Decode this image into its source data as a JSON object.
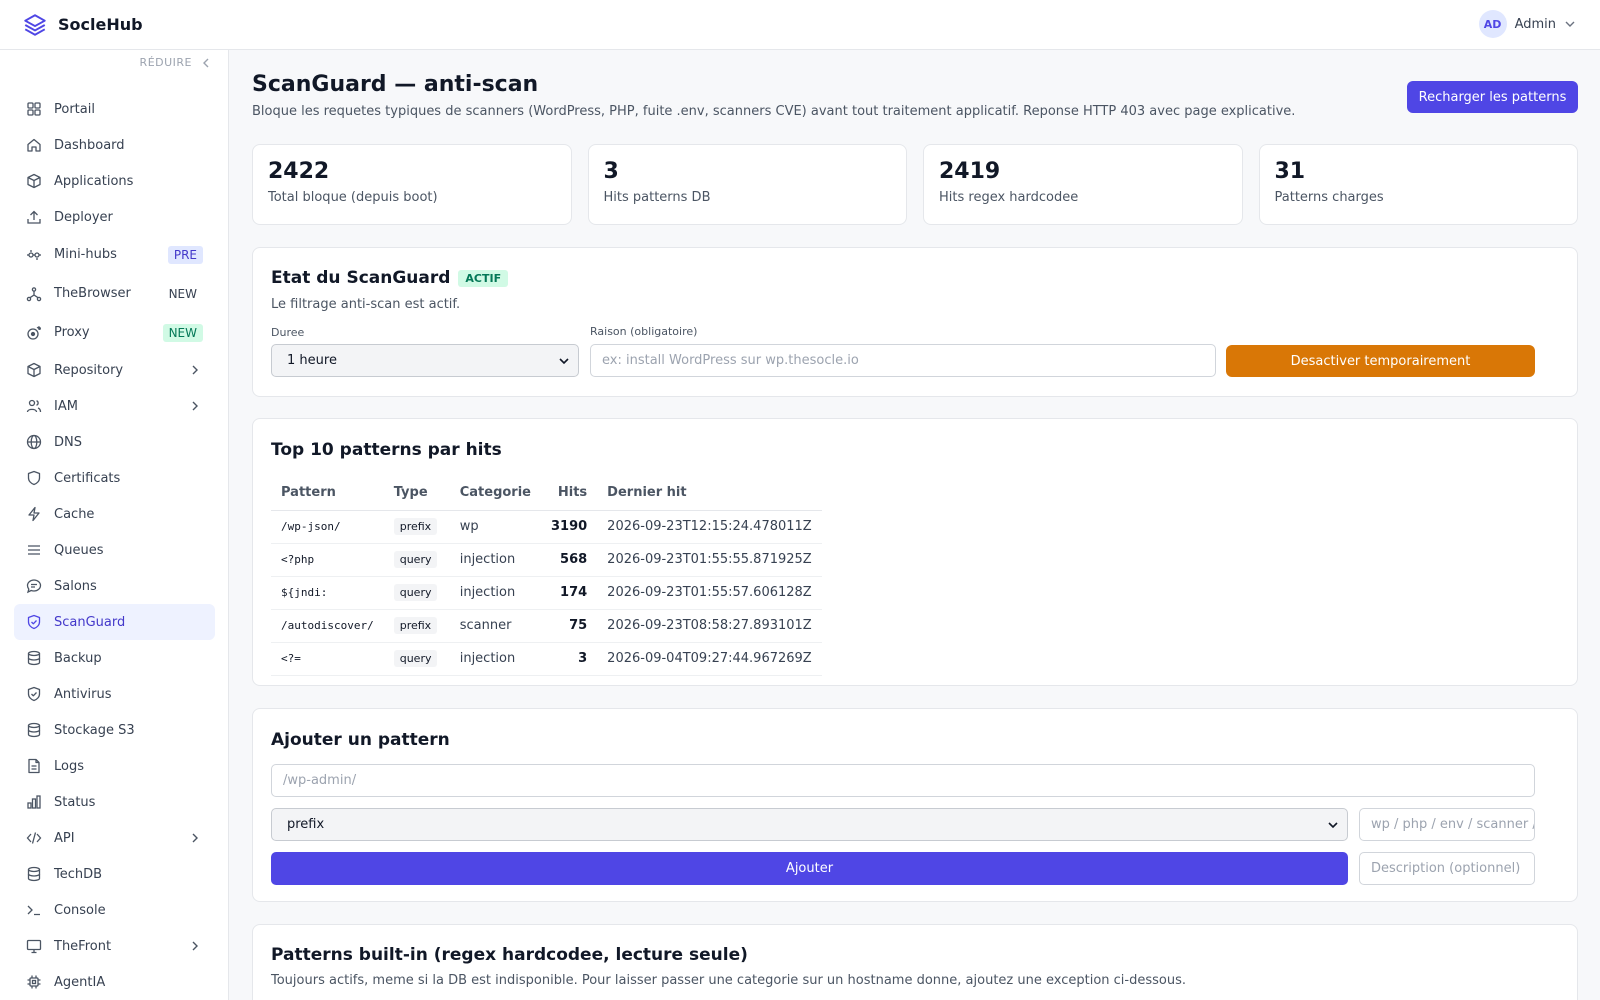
{
  "header": {
    "brand": "SocleHub",
    "user_initials": "AD",
    "user_name": "Admin"
  },
  "sidebar": {
    "collapse_label": "RÉDUIRE",
    "items": [
      {
        "label": "Portail",
        "icon": "grid-icon"
      },
      {
        "label": "Dashboard",
        "icon": "home-icon"
      },
      {
        "label": "Applications",
        "icon": "box-icon"
      },
      {
        "label": "Deployer",
        "icon": "upload-icon"
      },
      {
        "label": "Mini-hubs",
        "icon": "sliders-icon",
        "badge": "PRE"
      },
      {
        "label": "TheBrowser",
        "icon": "network-icon",
        "badge": "NEW"
      },
      {
        "label": "Proxy",
        "icon": "radar-icon",
        "badge": "NEW"
      },
      {
        "label": "Repository",
        "icon": "package-icon"
      },
      {
        "label": "IAM",
        "icon": "users-icon"
      },
      {
        "label": "DNS",
        "icon": "globe-icon"
      },
      {
        "label": "Certificats",
        "icon": "shield-icon"
      },
      {
        "label": "Cache",
        "icon": "bolt-icon"
      },
      {
        "label": "Queues",
        "icon": "menu-icon"
      },
      {
        "label": "Salons",
        "icon": "chat-icon"
      },
      {
        "label": "ScanGuard",
        "icon": "shield-check-icon"
      },
      {
        "label": "Backup",
        "icon": "database-icon"
      },
      {
        "label": "Antivirus",
        "icon": "shield-check-icon"
      },
      {
        "label": "Stockage S3",
        "icon": "database-icon"
      },
      {
        "label": "Logs",
        "icon": "file-icon"
      },
      {
        "label": "Status",
        "icon": "bar-chart-icon"
      },
      {
        "label": "API",
        "icon": "code-icon"
      },
      {
        "label": "TechDB",
        "icon": "database-icon"
      },
      {
        "label": "Console",
        "icon": "terminal-icon"
      },
      {
        "label": "TheFront",
        "icon": "monitor-icon"
      },
      {
        "label": "AgentIA",
        "icon": "cpu-icon"
      }
    ]
  },
  "page": {
    "title": "ScanGuard — anti-scan",
    "subtitle": "Bloque les requetes typiques de scanners (WordPress, PHP, fuite .env, scanners CVE) avant tout traitement applicatif. Reponse HTTP 403 avec page explicative.",
    "reload_button": "Recharger les patterns"
  },
  "stats": [
    {
      "value": "2422",
      "label": "Total bloque (depuis boot)"
    },
    {
      "value": "3",
      "label": "Hits patterns DB"
    },
    {
      "value": "2419",
      "label": "Hits regex hardcodee"
    },
    {
      "value": "31",
      "label": "Patterns charges"
    }
  ],
  "state": {
    "title": "Etat du ScanGuard",
    "status_badge": "ACTIF",
    "status_text": "Le filtrage anti-scan est actif.",
    "duration_label": "Duree",
    "duration_value": "1 heure",
    "reason_label": "Raison (obligatoire)",
    "reason_placeholder": "ex: install WordPress sur wp.thesocle.io",
    "disable_button": "Desactiver temporairement"
  },
  "top_patterns": {
    "title": "Top 10 patterns par hits",
    "columns": [
      "Pattern",
      "Type",
      "Categorie",
      "Hits",
      "Dernier hit"
    ],
    "rows": [
      {
        "pattern": "/wp-json/",
        "type": "prefix",
        "category": "wp",
        "hits": "3190",
        "last_hit": "2026-09-23T12:15:24.478011Z"
      },
      {
        "pattern": "<?php",
        "type": "query",
        "category": "injection",
        "hits": "568",
        "last_hit": "2026-09-23T01:55:55.871925Z"
      },
      {
        "pattern": "${jndi:",
        "type": "query",
        "category": "injection",
        "hits": "174",
        "last_hit": "2026-09-23T01:55:57.606128Z"
      },
      {
        "pattern": "/autodiscover/",
        "type": "prefix",
        "category": "scanner",
        "hits": "75",
        "last_hit": "2026-09-23T08:58:27.893101Z"
      },
      {
        "pattern": "<?=",
        "type": "query",
        "category": "injection",
        "hits": "3",
        "last_hit": "2026-09-04T09:27:44.967269Z"
      }
    ]
  },
  "add_pattern": {
    "title": "Ajouter un pattern",
    "pattern_placeholder": "/wp-admin/",
    "type_value": "prefix",
    "category_placeholder": "wp / php / env / scanner / ...",
    "submit_button": "Ajouter",
    "description_placeholder": "Description (optionnel)"
  },
  "builtin": {
    "title": "Patterns built-in (regex hardcodee, lecture seule)",
    "subtitle": "Toujours actifs, meme si la DB est indisponible. Pour laisser passer une categorie sur un hostname donne, ajoutez une exception ci-dessous."
  }
}
